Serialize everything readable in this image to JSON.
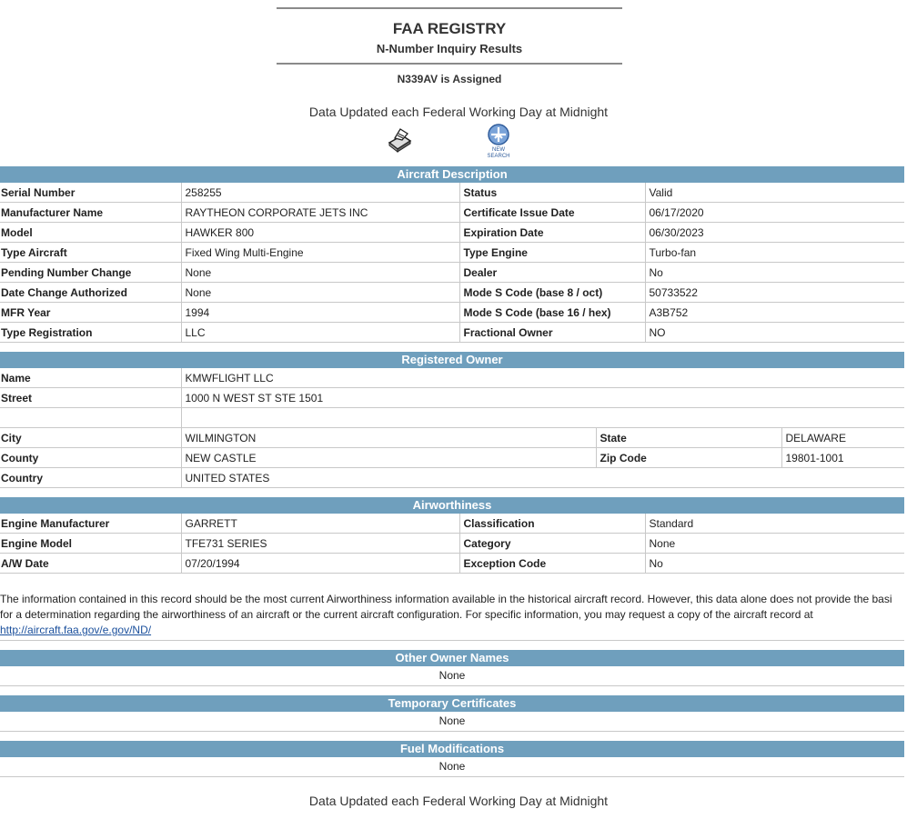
{
  "header": {
    "title": "FAA REGISTRY",
    "subtitle": "N-Number Inquiry Results",
    "assigned": "N339AV is Assigned",
    "updated": "Data Updated each Federal Working Day at Midnight"
  },
  "icons": {
    "print": "printer-icon",
    "search": "new-search-icon",
    "search_text_1": "NEW",
    "search_text_2": "SEARCH"
  },
  "aircraft": {
    "heading": "Aircraft Description",
    "rows": [
      [
        "Serial Number",
        "258255",
        "Status",
        "Valid"
      ],
      [
        "Manufacturer Name",
        "RAYTHEON CORPORATE JETS INC",
        "Certificate Issue Date",
        "06/17/2020"
      ],
      [
        "Model",
        "HAWKER 800",
        "Expiration Date",
        "06/30/2023"
      ],
      [
        "Type Aircraft",
        "Fixed Wing Multi-Engine",
        "Type Engine",
        "Turbo-fan"
      ],
      [
        "Pending Number Change",
        "None",
        "Dealer",
        "No"
      ],
      [
        "Date Change Authorized",
        "None",
        "Mode S Code (base 8 / oct)",
        "50733522"
      ],
      [
        "MFR Year",
        "1994",
        "Mode S Code (base 16 / hex)",
        "A3B752"
      ],
      [
        "Type Registration",
        "LLC",
        "Fractional Owner",
        "NO"
      ]
    ]
  },
  "owner": {
    "heading": "Registered Owner",
    "name_label": "Name",
    "name": "KMWFLIGHT LLC",
    "street_label": "Street",
    "street": "1000 N WEST ST STE 1501",
    "street2": "",
    "city_label": "City",
    "city": "WILMINGTON",
    "state_label": "State",
    "state": "DELAWARE",
    "county_label": "County",
    "county": "NEW CASTLE",
    "zip_label": "Zip Code",
    "zip": "19801-1001",
    "country_label": "Country",
    "country": "UNITED STATES"
  },
  "airworthiness": {
    "heading": "Airworthiness",
    "rows": [
      [
        "Engine Manufacturer",
        "GARRETT",
        "Classification",
        "Standard"
      ],
      [
        "Engine Model",
        "TFE731 SERIES",
        "Category",
        "None"
      ],
      [
        "A/W Date",
        "07/20/1994",
        "Exception Code",
        "No"
      ]
    ],
    "note_line1": "The information contained in this record should be the most current Airworthiness information available in the historical aircraft record. However, this data alone does not provide the basi",
    "note_line2": "for a determination regarding the airworthiness of an aircraft or the current aircraft configuration. For specific information, you may request a copy of the aircraft record at",
    "note_link": "http://aircraft.faa.gov/e.gov/ND/"
  },
  "other_owners": {
    "heading": "Other Owner Names",
    "value": "None"
  },
  "temp_certs": {
    "heading": "Temporary Certificates",
    "value": "None"
  },
  "fuel_mods": {
    "heading": "Fuel Modifications",
    "value": "None"
  },
  "footer": "Data Updated each Federal Working Day at Midnight",
  "colors": {
    "section_header": "#6f9fbd",
    "link": "#1a4f9c"
  }
}
